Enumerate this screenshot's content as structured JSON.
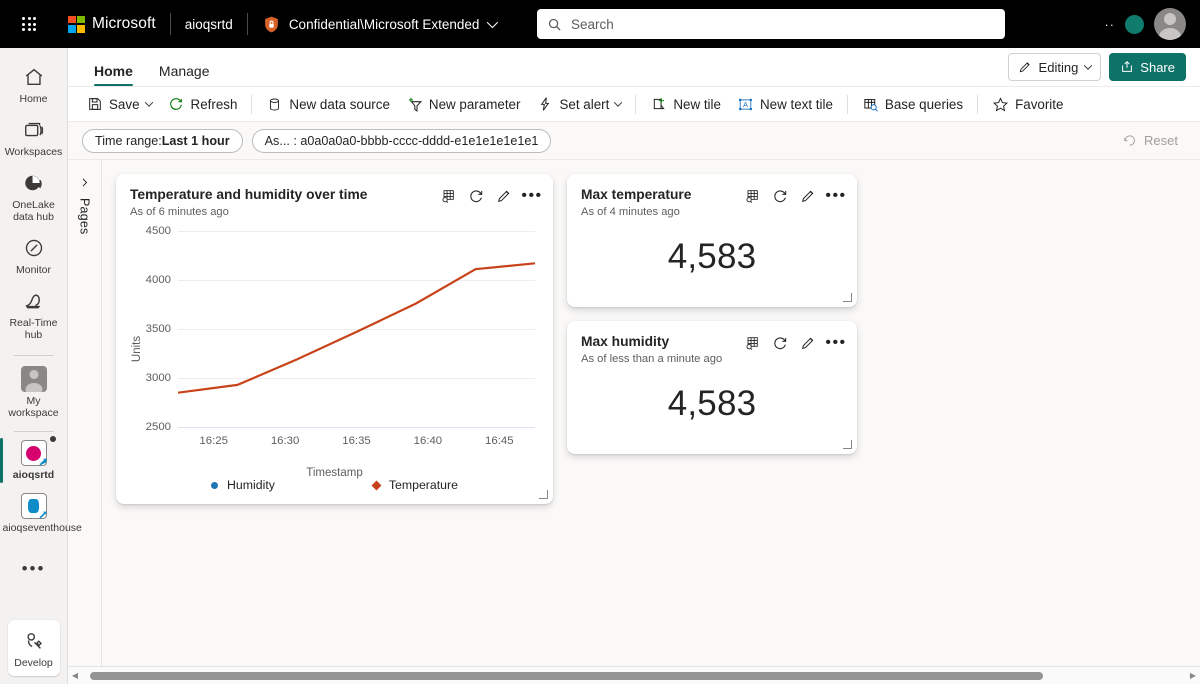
{
  "topbar": {
    "waffle_icon": "app-launcher-icon",
    "brand": "Microsoft",
    "workspace": "aioqsrtd",
    "sensitivity_icon": "sensitivity-shield-icon",
    "sensitivity_label": "Confidential\\Microsoft Extended",
    "search_icon": "search-icon",
    "search_placeholder": "Search",
    "search_value": "",
    "copilot_icon": "copilot-icon",
    "avatar": "account-avatar"
  },
  "header": {
    "tabs": [
      {
        "label": "Home",
        "active": true
      },
      {
        "label": "Manage",
        "active": false
      }
    ],
    "editing_label": "Editing",
    "editing_icon": "pencil-icon",
    "share_label": "Share",
    "share_icon": "share-icon",
    "accent_teal": "#0f7268"
  },
  "commandbar": {
    "items": [
      {
        "label": "Save",
        "icon": "save-icon",
        "caret": true
      },
      {
        "label": "Refresh",
        "icon": "refresh-icon",
        "caret": false
      },
      {
        "label": "New data source",
        "icon": "database-icon",
        "caret": false
      },
      {
        "label": "New parameter",
        "icon": "new-parameter-icon",
        "caret": false
      },
      {
        "label": "Set alert",
        "icon": "alert-bolt-icon",
        "caret": true
      },
      {
        "label": "New tile",
        "icon": "new-tile-icon",
        "caret": false
      },
      {
        "label": "New text tile",
        "icon": "new-text-tile-icon",
        "caret": false
      },
      {
        "label": "Base queries",
        "icon": "base-queries-icon",
        "caret": false
      },
      {
        "label": "Favorite",
        "icon": "star-icon",
        "caret": false
      }
    ]
  },
  "filterbar": {
    "time_range_prefix": "Time range: ",
    "time_range_value": "Last 1 hour",
    "parameter_pill": "As... : a0a0a0a0-bbbb-cccc-dddd-e1e1e1e1e1e1",
    "reset_label": "Reset",
    "reset_icon": "reset-history-icon",
    "reset_disabled": true
  },
  "pages_panel": {
    "expand_icon": "chevron-right-icon",
    "label": "Pages"
  },
  "sidebar": {
    "items": [
      {
        "label": "Home",
        "icon": "home-icon",
        "selected": false
      },
      {
        "label": "Workspaces",
        "icon": "workspaces-icon",
        "selected": false
      },
      {
        "label": "OneLake data hub",
        "icon": "onelake-data-hub-icon",
        "selected": false
      },
      {
        "label": "Monitor",
        "icon": "monitor-icon",
        "selected": false
      },
      {
        "label": "Real-Time hub",
        "icon": "real-time-hub-icon",
        "selected": false
      },
      {
        "label": "My workspace",
        "icon": "my-workspace-avatar-icon",
        "selected": false
      },
      {
        "label": "aioqsrtd",
        "icon": "kql-dashboard-icon",
        "selected": true,
        "unread": true
      },
      {
        "label": "aioqseventhouse",
        "icon": "eventhouse-icon",
        "selected": false
      }
    ],
    "more_icon": "more-ellipsis-icon",
    "develop": {
      "label": "Develop",
      "icon": "develop-wrench-icon"
    }
  },
  "tiles": [
    {
      "kind": "chart",
      "title": "Temperature and humidity over time",
      "subtitle": "As of 6 minutes ago",
      "actions": [
        "explore-data-icon",
        "refresh-icon",
        "edit-pencil-icon",
        "more-options-icon"
      ],
      "resize_handle": "resize-grip"
    },
    {
      "kind": "kpi",
      "title": "Max temperature",
      "subtitle": "As of 4 minutes ago",
      "value": "4,583",
      "actions": [
        "explore-data-icon",
        "refresh-icon",
        "edit-pencil-icon",
        "more-options-icon"
      ],
      "resize_handle": "resize-grip"
    },
    {
      "kind": "kpi",
      "title": "Max humidity",
      "subtitle": "As of less than a minute ago",
      "value": "4,583",
      "actions": [
        "explore-data-icon",
        "refresh-icon",
        "edit-pencil-icon",
        "more-options-icon"
      ],
      "resize_handle": "resize-grip"
    }
  ],
  "chart_data": {
    "type": "line",
    "title": "Temperature and humidity over time",
    "xlabel": "Timestamp",
    "ylabel": "Units",
    "ylim": [
      2500,
      4500
    ],
    "yticks": [
      2500,
      3000,
      3500,
      4000,
      4500
    ],
    "xticks": [
      "16:25",
      "16:30",
      "16:35",
      "16:40",
      "16:45"
    ],
    "grid": true,
    "legend_position": "bottom",
    "series": [
      {
        "name": "Humidity",
        "color": "#1f77b4",
        "marker": "circle",
        "visible_in_plot": false,
        "x": [],
        "values": []
      },
      {
        "name": "Temperature",
        "color": "#c8431a",
        "marker": "diamond",
        "visible_in_plot": true,
        "x": [
          "16:23",
          "16:25",
          "16:30",
          "16:35",
          "16:40",
          "16:45",
          "16:46"
        ],
        "values": [
          2850,
          2930,
          3190,
          3470,
          3760,
          4110,
          4170
        ]
      }
    ]
  },
  "scrollbar": {
    "left_arrow": "scroll-left-arrow",
    "right_arrow": "scroll-right-arrow",
    "thumb": "horizontal-scroll-thumb"
  }
}
